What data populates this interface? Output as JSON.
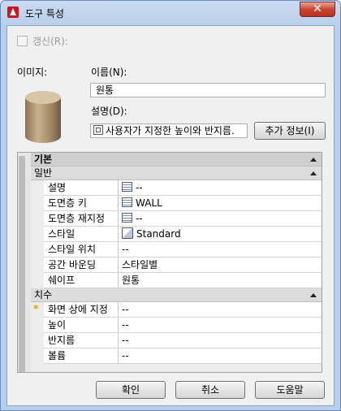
{
  "window": {
    "title": "도구 특성",
    "close_label": "✕"
  },
  "refresh": {
    "label": "갱신(R):",
    "checked": false
  },
  "image_label": "이미지:",
  "name": {
    "label": "이름(N):",
    "value": "원통"
  },
  "description": {
    "label": "설명(D):",
    "value": "사용자가 지정한 높이와 반지름.",
    "more_button": "추가 정보(I)"
  },
  "grid": {
    "header": "기본",
    "sections": [
      {
        "title": "일반",
        "rows": [
          {
            "name": "설명",
            "value": "--",
            "icon": "table-icon"
          },
          {
            "name": "도면층 키",
            "value": "WALL",
            "icon": "table-icon"
          },
          {
            "name": "도면층 재지정",
            "value": "--",
            "icon": "table-icon"
          },
          {
            "name": "스타일",
            "value": "Standard",
            "icon": "style-icon"
          },
          {
            "name": "스타일 위치",
            "value": "--"
          },
          {
            "name": "공간 바운딩",
            "value": "스타일별"
          },
          {
            "name": "쉐이프",
            "value": "원통"
          }
        ]
      },
      {
        "title": "치수",
        "rows": [
          {
            "name": "화면 상에 지정",
            "value": "--",
            "marker": "*"
          },
          {
            "name": "높이",
            "value": "--"
          },
          {
            "name": "반지름",
            "value": "--"
          },
          {
            "name": "볼륨",
            "value": "--"
          }
        ]
      }
    ]
  },
  "buttons": {
    "ok": "확인",
    "cancel": "취소",
    "help": "도움말"
  },
  "colors": {
    "title_gradient": "#b9cfe9",
    "close_button": "#c9452f",
    "marker": "#e89a00"
  }
}
